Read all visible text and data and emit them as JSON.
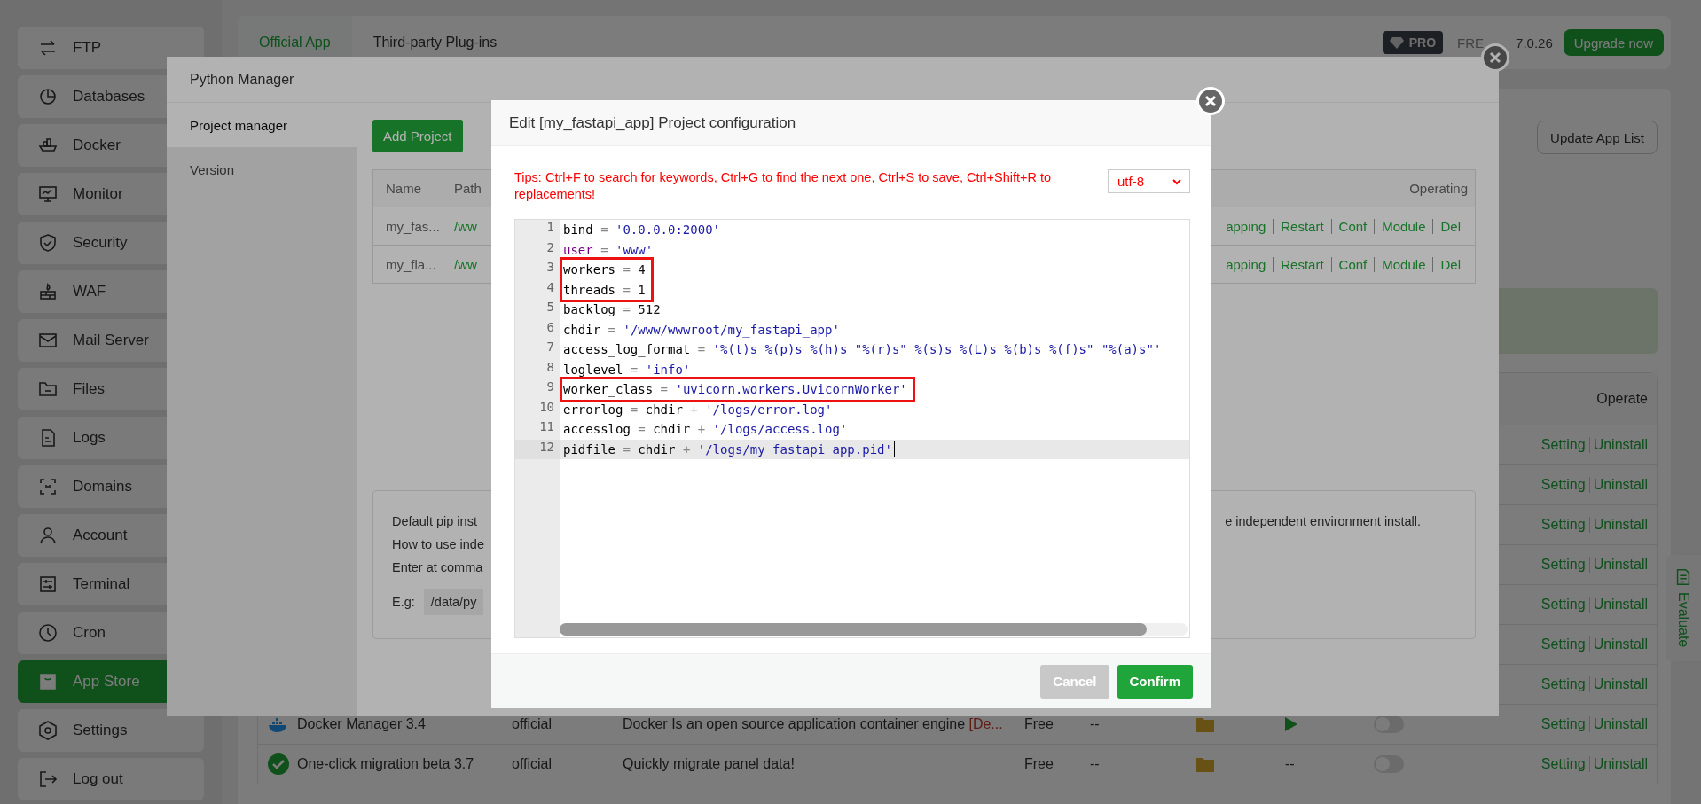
{
  "sidebar": {
    "items": [
      {
        "label": "FTP",
        "selected": false
      },
      {
        "label": "Databases",
        "selected": false
      },
      {
        "label": "Docker",
        "selected": false
      },
      {
        "label": "Monitor",
        "selected": false
      },
      {
        "label": "Security",
        "selected": false
      },
      {
        "label": "WAF",
        "selected": false
      },
      {
        "label": "Mail Server",
        "selected": false
      },
      {
        "label": "Files",
        "selected": false
      },
      {
        "label": "Logs",
        "selected": false
      },
      {
        "label": "Domains",
        "selected": false
      },
      {
        "label": "Account",
        "selected": false
      },
      {
        "label": "Terminal",
        "selected": false
      },
      {
        "label": "Cron",
        "selected": false
      },
      {
        "label": "App Store",
        "selected": true
      },
      {
        "label": "Settings",
        "selected": false
      },
      {
        "label": "Log out",
        "selected": false
      }
    ]
  },
  "top_bar": {
    "tabs": [
      {
        "label": "Official App",
        "selected": true
      },
      {
        "label": "Third-party Plug-ins",
        "selected": false
      }
    ],
    "badge": "PRO",
    "edition": "FRE",
    "version": "7.0.26",
    "upgrade_button": "Upgrade now"
  },
  "update_button": "Update App List",
  "app_table": {
    "operate_header": "Operate",
    "rows": [
      {
        "actions": [
          "Setting",
          "Uninstall"
        ]
      },
      {
        "actions": [
          "Setting",
          "Uninstall"
        ]
      },
      {
        "actions": [
          "Setting",
          "Uninstall"
        ]
      },
      {
        "actions": [
          "Setting",
          "Uninstall"
        ]
      },
      {
        "actions": [
          "Setting",
          "Uninstall"
        ]
      },
      {
        "actions": [
          "Setting",
          "Uninstall"
        ]
      },
      {
        "actions": [
          "Setting",
          "Uninstall"
        ]
      },
      {
        "kind": "whale",
        "name": "Docker Manager 3.4",
        "type": "official",
        "description": "Docker Is an open source application container engine ",
        "description_tag": "[De...",
        "price": "Free",
        "expire": "--",
        "on": false,
        "actions": [
          "Setting",
          "Uninstall"
        ]
      },
      {
        "kind": "check",
        "name": "One-click migration beta 3.7",
        "type": "official",
        "description": "Quickly migrate panel data!",
        "price": "Free",
        "expire": "--",
        "status": "--",
        "on": false,
        "actions": [
          "Setting",
          "Uninstall"
        ]
      }
    ]
  },
  "evaluate_tab": "Evaluate",
  "python_manager": {
    "title": "Python Manager",
    "nav": [
      {
        "label": "Project manager",
        "selected": true
      },
      {
        "label": "Version",
        "selected": false
      }
    ],
    "add_button": "Add Project",
    "projects": {
      "columns": [
        "Name",
        "Path"
      ],
      "operating_header": "Operating",
      "rows": [
        {
          "name": "my_fas...",
          "path": "/ww",
          "actions": [
            "apping",
            "Restart",
            "Conf",
            "Module",
            "Del"
          ]
        },
        {
          "name": "my_fla...",
          "path": "/ww",
          "actions": [
            "apping",
            "Restart",
            "Conf",
            "Module",
            "Del"
          ]
        }
      ]
    },
    "info": {
      "lines": [
        {
          "left": "Default pip inst",
          "right": "e independent environment install."
        },
        {
          "left": "How to use inde"
        },
        {
          "left": "Enter at comma"
        }
      ],
      "example_label": "E.g:",
      "example_value": "/data/py"
    }
  },
  "edit_dialog": {
    "title": "Edit [my_fastapi_app] Project configuration",
    "tips": "Tips: Ctrl+F to search for keywords, Ctrl+G to find the next one, Ctrl+S to save, Ctrl+Shift+R to replacements!",
    "encoding": "utf-8",
    "lines": [
      {
        "number": "1",
        "boxed": false,
        "active": false,
        "tokens": [
          {
            "kind": "name",
            "text": "bind"
          },
          {
            "kind": "op",
            "text": " = "
          },
          {
            "kind": "string",
            "text": "'0.0.0.0:2000'"
          }
        ]
      },
      {
        "number": "2",
        "boxed": false,
        "active": false,
        "tokens": [
          {
            "kind": "keyword",
            "text": "user"
          },
          {
            "kind": "op",
            "text": " = "
          },
          {
            "kind": "string",
            "text": "'www'"
          }
        ]
      },
      {
        "number": "3",
        "boxed": true,
        "active": false,
        "tokens": [
          {
            "kind": "name",
            "text": "workers"
          },
          {
            "kind": "op",
            "text": " = "
          },
          {
            "kind": "number",
            "text": "4"
          }
        ]
      },
      {
        "number": "4",
        "boxed": true,
        "active": false,
        "tokens": [
          {
            "kind": "name",
            "text": "threads"
          },
          {
            "kind": "op",
            "text": " = "
          },
          {
            "kind": "number",
            "text": "1"
          }
        ]
      },
      {
        "number": "5",
        "boxed": false,
        "active": false,
        "tokens": [
          {
            "kind": "name",
            "text": "backlog"
          },
          {
            "kind": "op",
            "text": " = "
          },
          {
            "kind": "number",
            "text": "512"
          }
        ]
      },
      {
        "number": "6",
        "boxed": false,
        "active": false,
        "tokens": [
          {
            "kind": "name",
            "text": "chdir"
          },
          {
            "kind": "op",
            "text": " = "
          },
          {
            "kind": "string",
            "text": "'/www/wwwroot/my_fastapi_app'"
          }
        ]
      },
      {
        "number": "7",
        "boxed": false,
        "active": false,
        "tokens": [
          {
            "kind": "name",
            "text": "access_log_format"
          },
          {
            "kind": "op",
            "text": " = "
          },
          {
            "kind": "string",
            "text": "'%(t)s %(p)s %(h)s \"%(r)s\" %(s)s %(L)s %(b)s %(f)s\" \"%(a)s\"'"
          }
        ]
      },
      {
        "number": "8",
        "boxed": false,
        "active": false,
        "tokens": [
          {
            "kind": "name",
            "text": "loglevel"
          },
          {
            "kind": "op",
            "text": " = "
          },
          {
            "kind": "string",
            "text": "'info'"
          }
        ]
      },
      {
        "number": "9",
        "boxed": true,
        "active": false,
        "tokens": [
          {
            "kind": "name",
            "text": "worker_class"
          },
          {
            "kind": "op",
            "text": " = "
          },
          {
            "kind": "string",
            "text": "'uvicorn.workers.UvicornWorker'"
          }
        ]
      },
      {
        "number": "10",
        "boxed": false,
        "active": false,
        "tokens": [
          {
            "kind": "name",
            "text": "errorlog"
          },
          {
            "kind": "op",
            "text": " = "
          },
          {
            "kind": "name",
            "text": "chdir"
          },
          {
            "kind": "op",
            "text": " + "
          },
          {
            "kind": "string",
            "text": "'/logs/error.log'"
          }
        ]
      },
      {
        "number": "11",
        "boxed": false,
        "active": false,
        "tokens": [
          {
            "kind": "name",
            "text": "accesslog"
          },
          {
            "kind": "op",
            "text": " = "
          },
          {
            "kind": "name",
            "text": "chdir"
          },
          {
            "kind": "op",
            "text": " + "
          },
          {
            "kind": "string",
            "text": "'/logs/access.log'"
          }
        ]
      },
      {
        "number": "12",
        "boxed": false,
        "active": true,
        "tokens": [
          {
            "kind": "name",
            "text": "pidfile"
          },
          {
            "kind": "op",
            "text": " = "
          },
          {
            "kind": "name",
            "text": "chdir"
          },
          {
            "kind": "op",
            "text": " + "
          },
          {
            "kind": "string",
            "text": "'/logs/my_fastapi_app.pid'"
          }
        ]
      }
    ],
    "buttons": [
      {
        "label": "Cancel",
        "kind": "secondary"
      },
      {
        "label": "Confirm",
        "kind": "primary"
      }
    ]
  }
}
